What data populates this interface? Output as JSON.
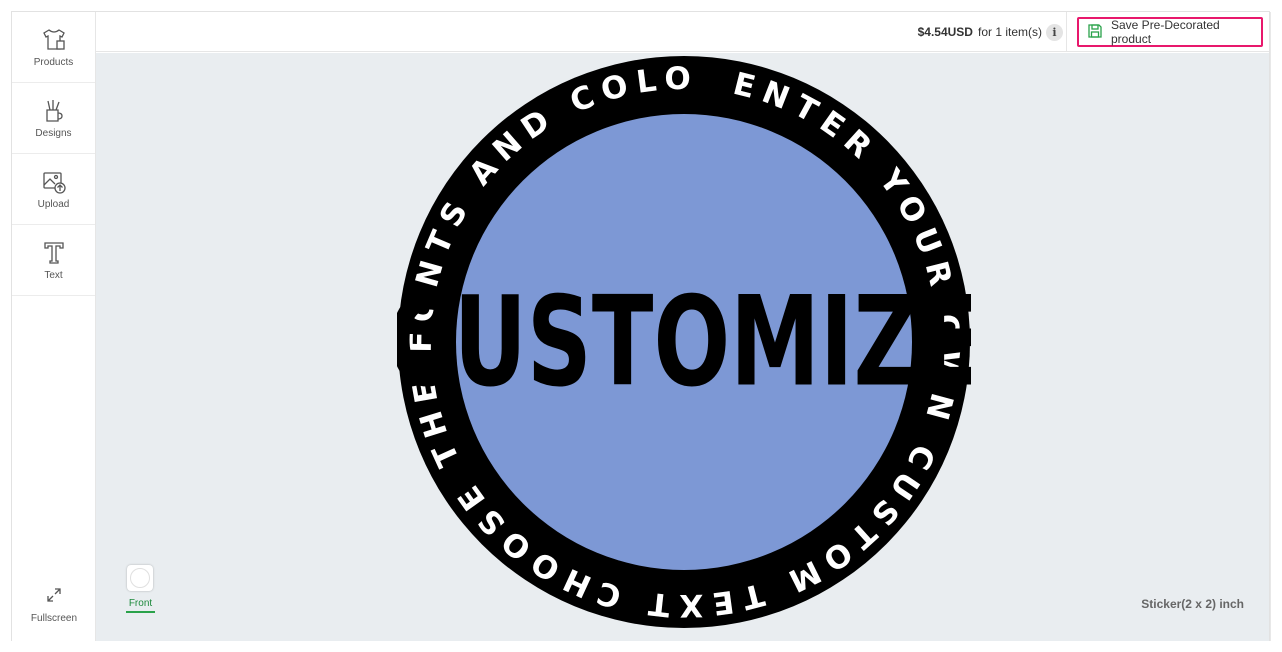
{
  "sidebar": {
    "items": [
      {
        "label": "Products",
        "icon": "tshirt-icon"
      },
      {
        "label": "Designs",
        "icon": "mug-brushes-icon"
      },
      {
        "label": "Upload",
        "icon": "image-upload-icon"
      },
      {
        "label": "Text",
        "icon": "text-icon"
      }
    ],
    "fullscreen_label": "Fullscreen"
  },
  "topbar": {
    "price_amount": "$4.54USD",
    "price_qty": "for 1 item(s)",
    "info_glyph": "i",
    "save_label": "Save Pre-Decorated product"
  },
  "canvas": {
    "ring_text": "ENTER YOUR OWN CUSTOM TEXT CHOOSE THE FONTS AND COLORS",
    "center_text": "CUSTOMIZE",
    "inner_color": "#7d98d5",
    "ring_color": "#000000",
    "ring_text_color": "#ffffff",
    "view_label": "Front",
    "size_label": "Sticker(2 x 2) inch"
  },
  "colors": {
    "accent_highlight": "#e8186c",
    "active_tab": "#2aa24a",
    "canvas_bg": "#e9edf0"
  }
}
